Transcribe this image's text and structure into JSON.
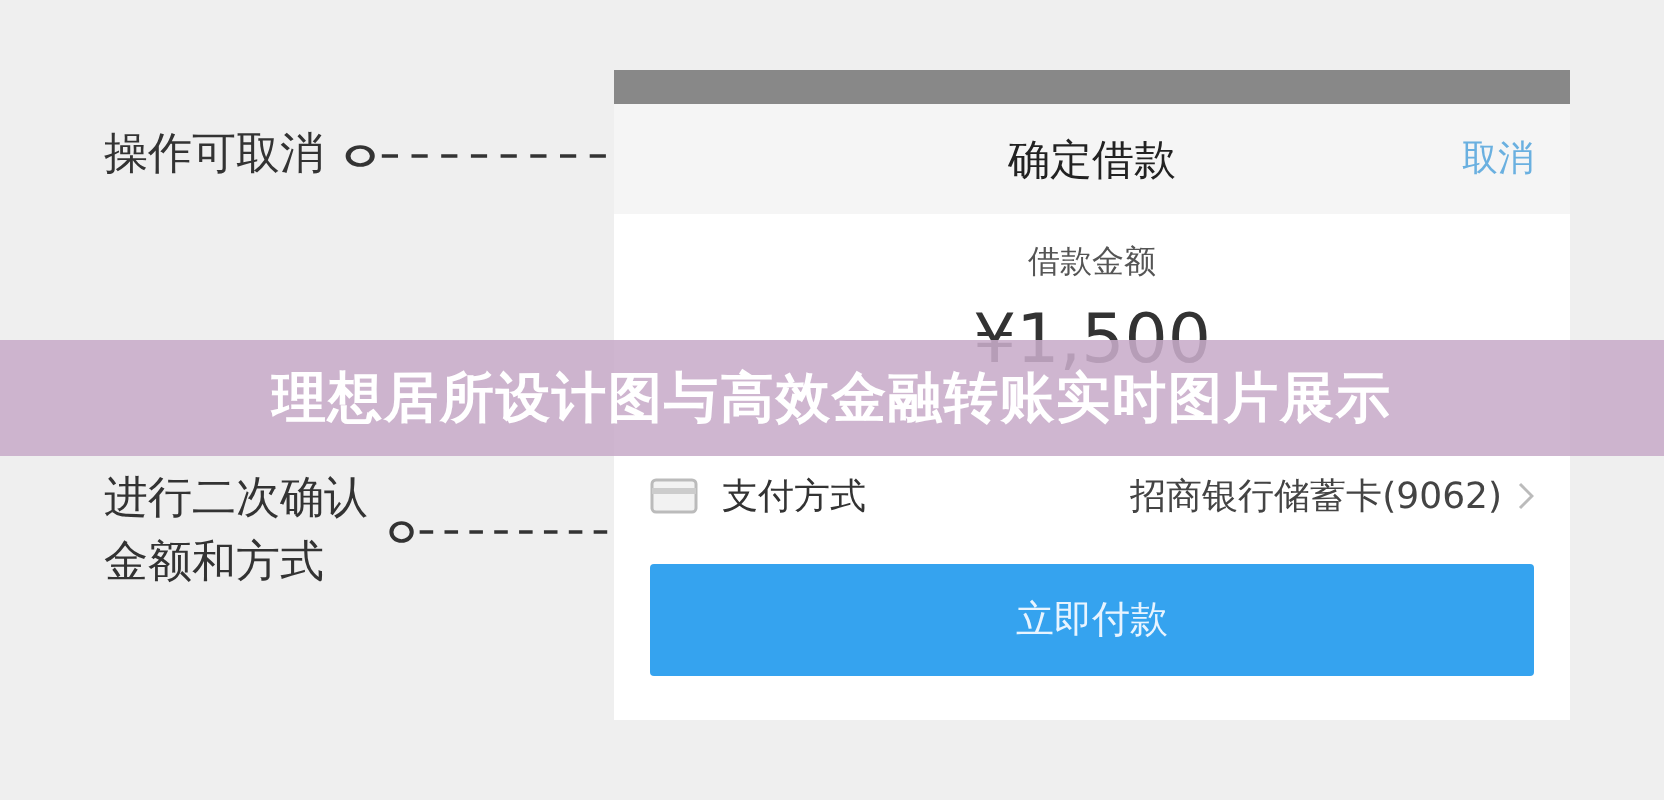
{
  "annotations": [
    {
      "lines": [
        "操作可取消"
      ]
    },
    {
      "lines": [
        "进行二次确认",
        "金额和方式"
      ]
    }
  ],
  "dialog": {
    "title": "确定借款",
    "cancel": "取消",
    "amount_label": "借款金额",
    "amount": "¥1,500",
    "payment_label": "支付方式",
    "payment_value": "招商银行储蓄卡(9062)",
    "pay_button": "立即付款"
  },
  "banner": {
    "text": "理想居所设计图与高效金融转账实时图片展示"
  }
}
